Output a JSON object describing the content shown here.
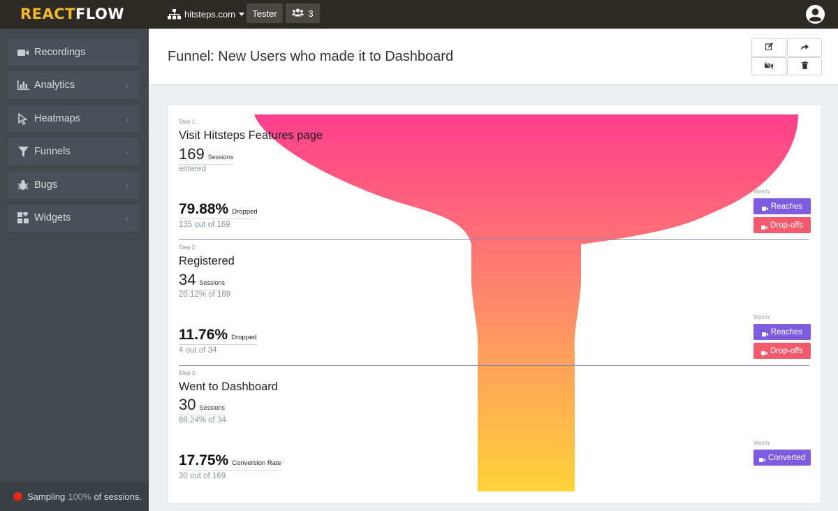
{
  "topbar": {
    "logo_part1": "REACT",
    "logo_part2": "FLOW",
    "site": "hitsteps.com",
    "tester_label": "Tester",
    "users_count": "3"
  },
  "sidebar": {
    "items": [
      {
        "label": "Recordings",
        "icon": "video-camera-icon"
      },
      {
        "label": "Analytics",
        "icon": "bar-chart-icon"
      },
      {
        "label": "Heatmaps",
        "icon": "cursor-icon"
      },
      {
        "label": "Funnels",
        "icon": "filter-icon"
      },
      {
        "label": "Bugs",
        "icon": "bug-icon"
      },
      {
        "label": "Widgets",
        "icon": "widgets-icon"
      }
    ],
    "sampling": {
      "prefix": "Sampling",
      "percent": "100%",
      "suffix": "of sessions."
    }
  },
  "header": {
    "title": "Funnel: New Users who made it to Dashboard",
    "actions": [
      "edit-icon",
      "share-icon",
      "recordings-off-icon",
      "trash-icon"
    ]
  },
  "funnel": {
    "colors": {
      "top": "#fe3e8c",
      "middle": "#fd8a6b",
      "bottom": "#fed339",
      "divider": "#8a8fc0"
    },
    "steps": [
      {
        "step_label": "Step 1:",
        "name": "Visit Hitsteps Features page",
        "count": "169",
        "unit": "Sessions",
        "sub": "entered",
        "outcome": {
          "pct": "79.88%",
          "label": "Dropped",
          "sub": "135 out of 169"
        },
        "watch": "Watch:",
        "buttons": [
          {
            "label": "Reaches",
            "style": "purple"
          },
          {
            "label": "Drop-offs",
            "style": "red"
          }
        ]
      },
      {
        "step_label": "Step 2:",
        "name": "Registered",
        "count": "34",
        "unit": "Sessions",
        "sub": "20.12% of 169",
        "outcome": {
          "pct": "11.76%",
          "label": "Dropped",
          "sub": "4 out of 34"
        },
        "watch": "Watch:",
        "buttons": [
          {
            "label": "Reaches",
            "style": "purple"
          },
          {
            "label": "Drop-offs",
            "style": "red"
          }
        ]
      },
      {
        "step_label": "Step 3:",
        "name": "Went to Dashboard",
        "count": "30",
        "unit": "Sessions",
        "sub": "88.24% of 34",
        "outcome": {
          "pct": "17.75%",
          "label": "Conversion Rate",
          "sub": "30 out of 169"
        },
        "watch": "Watch:",
        "buttons": [
          {
            "label": "Converted",
            "style": "purple"
          }
        ]
      }
    ]
  }
}
